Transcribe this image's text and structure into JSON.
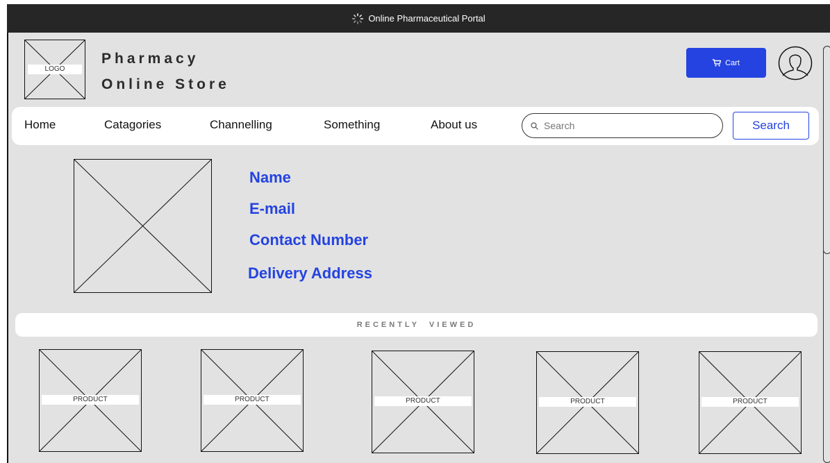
{
  "window": {
    "title": "Online Pharmaceutical Portal"
  },
  "header": {
    "logo_label": "LOGO",
    "store_name_line1": "Pharmacy",
    "store_name_line2": "Online Store",
    "cart_label": "Cart"
  },
  "nav": {
    "items": [
      "Home",
      "Catagories",
      "Channelling",
      "Something",
      "About us"
    ],
    "search_placeholder": "Search",
    "search_button": "Search"
  },
  "profile": {
    "fields": [
      "Name",
      "E-mail",
      "Contact Number",
      "Delivery Address"
    ]
  },
  "recently_viewed": {
    "title": "RECENTLY  VIEWED",
    "products": [
      "PRODUCT",
      "PRODUCT",
      "PRODUCT",
      "PRODUCT",
      "PRODUCT"
    ]
  },
  "colors": {
    "accent": "#2443e0",
    "background": "#e2e2e2",
    "titlebar": "#262626"
  }
}
